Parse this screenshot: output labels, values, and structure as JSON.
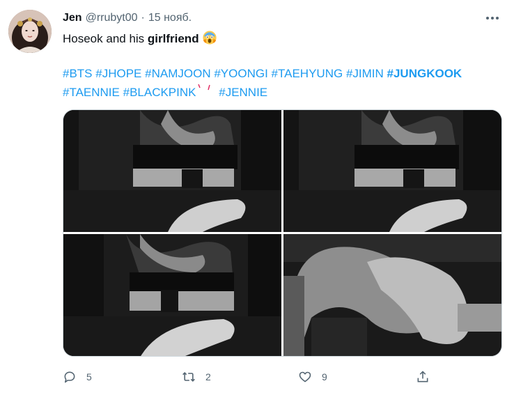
{
  "tweet": {
    "author_name": "Jen",
    "handle": "@rrubyt00",
    "separator": "·",
    "date": "15 нояб.",
    "text_before": "Hoseok and his ",
    "text_bold": "girlfriend",
    "emoji": "face-screaming-in-fear-emoji"
  },
  "hashtags": {
    "line1": [
      "#BTS",
      "#JHOPE",
      "#NAMJOON",
      "#YOONGI",
      "#TAEHYUNG",
      "#JIMIN",
      "#JUNGKOOK"
    ],
    "line2": [
      "#TAENNIE",
      "#BLACKPINK",
      "#JENNIE"
    ]
  },
  "actions": {
    "replies": "5",
    "retweets": "2",
    "likes": "9",
    "share": ""
  },
  "colors": {
    "link": "#1d9bf0",
    "muted": "#536471",
    "text": "#0f1419"
  },
  "icons": {
    "reply": "reply-icon",
    "retweet": "retweet-icon",
    "like": "heart-icon",
    "share": "share-icon",
    "more": "more-icon"
  }
}
